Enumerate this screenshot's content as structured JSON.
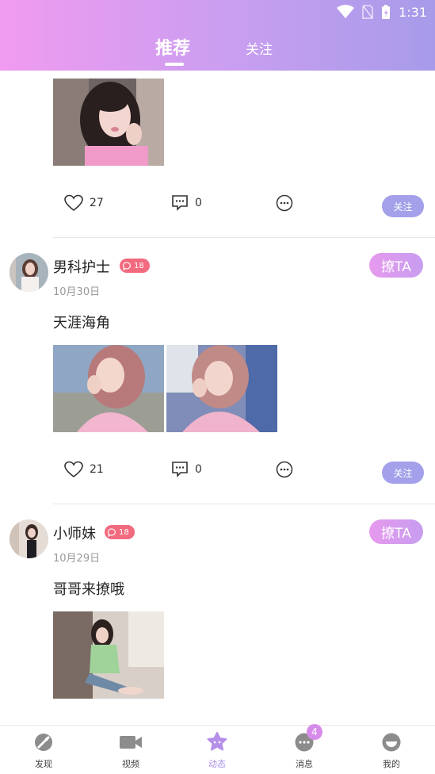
{
  "status_bar": {
    "time": "1:31"
  },
  "tabs": [
    {
      "label": "推荐",
      "active": true
    },
    {
      "label": "关注",
      "active": false
    }
  ],
  "posts": [
    {
      "likes": "27",
      "comments": "0",
      "follow_label": "关注"
    },
    {
      "username": "男科护士",
      "badge": "18",
      "date": "10月30日",
      "flirt_label": "撩TA",
      "text": "天涯海角",
      "likes": "21",
      "comments": "0",
      "follow_label": "关注"
    },
    {
      "username": "小师妹",
      "badge": "18",
      "date": "10月29日",
      "flirt_label": "撩TA",
      "text": "哥哥来撩哦"
    }
  ],
  "bottom_nav": [
    {
      "label": "发现",
      "icon": "discover-icon"
    },
    {
      "label": "视频",
      "icon": "video-icon"
    },
    {
      "label": "动态",
      "icon": "moments-icon",
      "active": true
    },
    {
      "label": "消息",
      "icon": "message-icon",
      "badge": "4"
    },
    {
      "label": "我的",
      "icon": "profile-icon"
    }
  ],
  "colors": {
    "accent": "#a4a0ea",
    "header_start": "#f09bf0",
    "header_end": "#a79be9",
    "badge": "#f26a7e"
  }
}
